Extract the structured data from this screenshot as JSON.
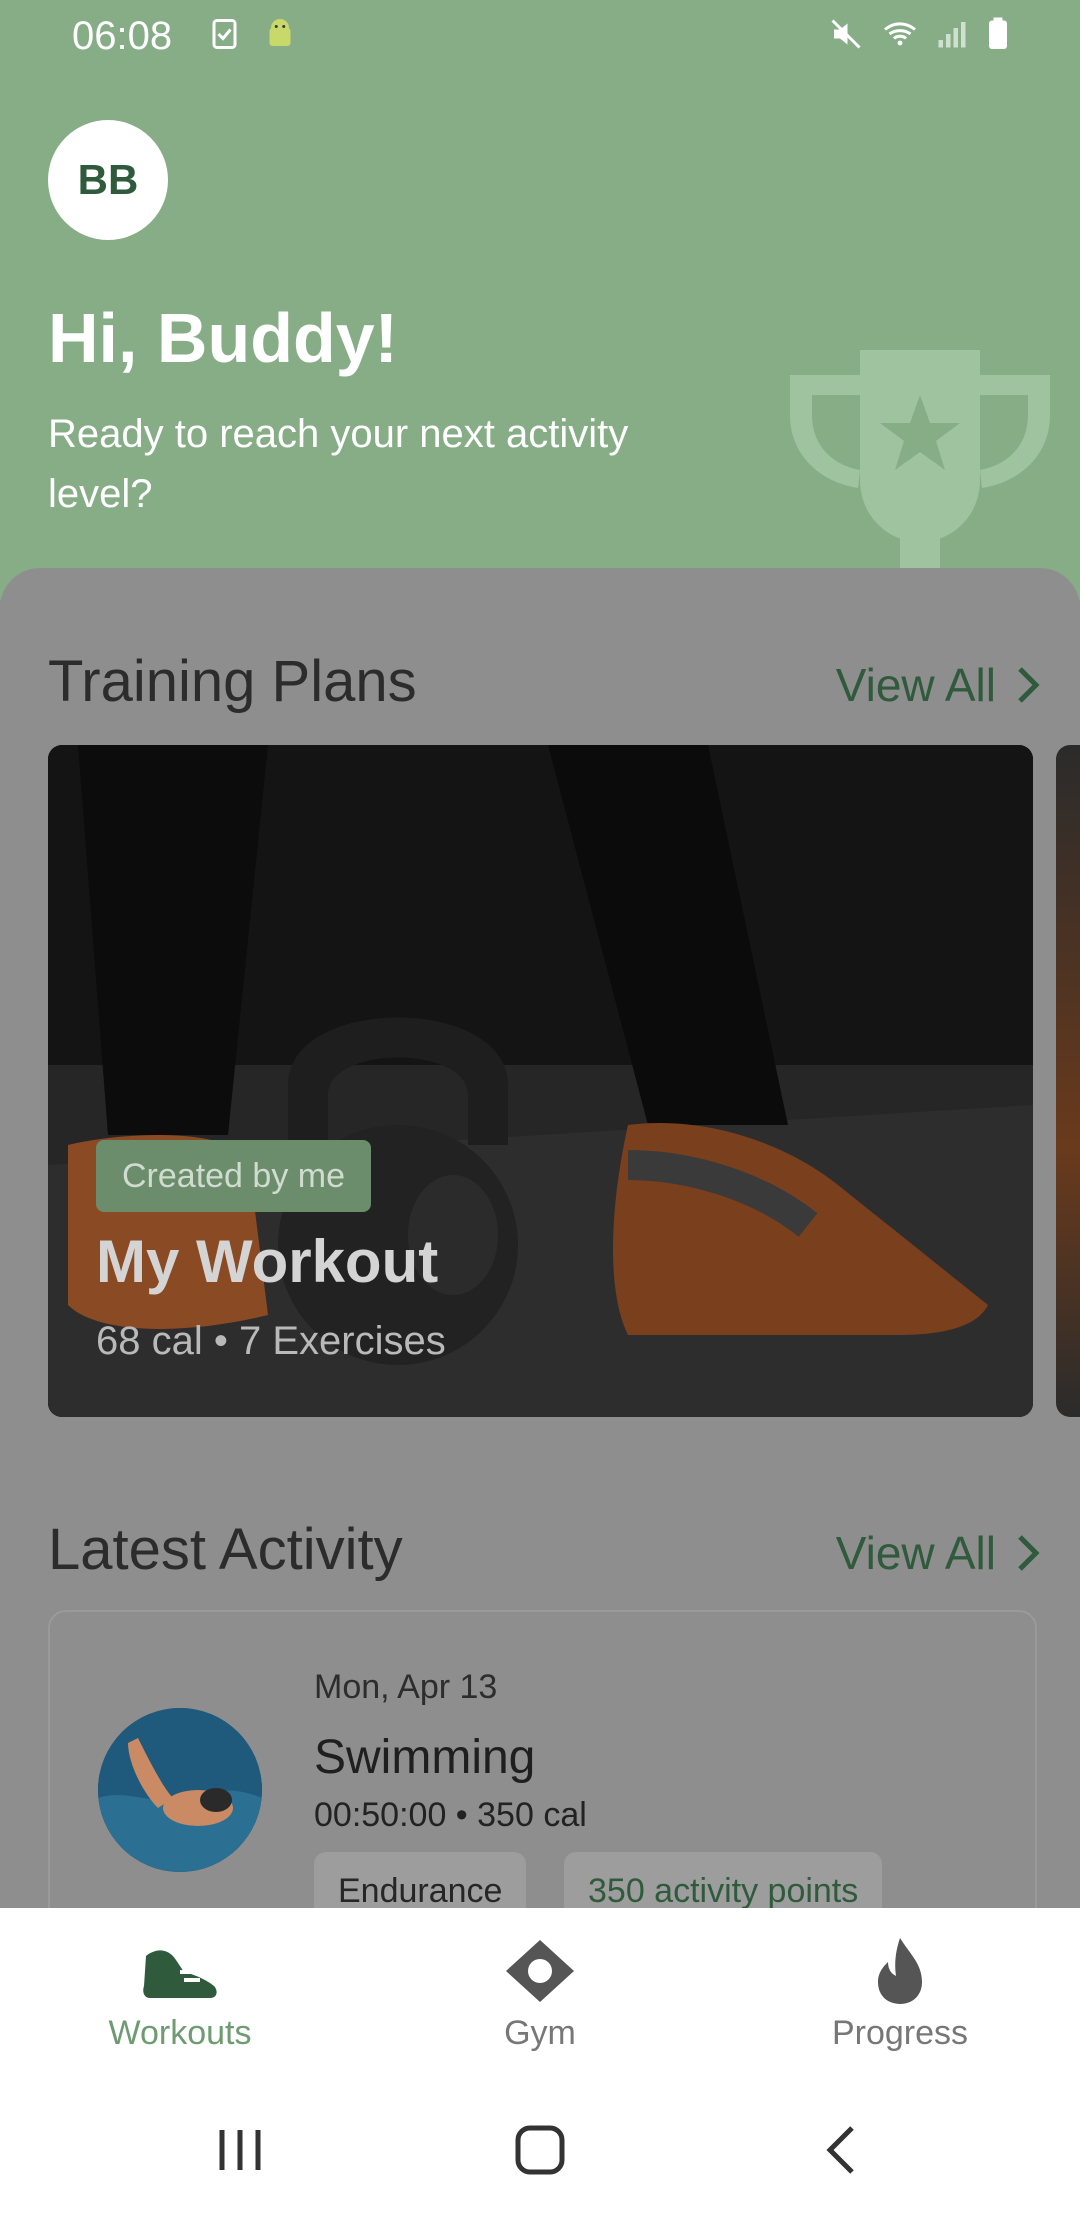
{
  "status_bar": {
    "time": "06:08",
    "icons": [
      "clipboard-check-icon",
      "android-icon",
      "mute-icon",
      "wifi-icon",
      "signal-icon",
      "battery-icon"
    ]
  },
  "header": {
    "avatar_initials": "BB",
    "greeting": "Hi, Buddy!",
    "subtitle": "Ready to reach your next activity level?",
    "illustration": "trophy-icon"
  },
  "training_plans": {
    "title": "Training Plans",
    "view_all": "View All",
    "card": {
      "badge": "Created by me",
      "title": "My Workout",
      "meta": "68 cal • 7 Exercises"
    }
  },
  "latest_activity": {
    "title": "Latest Activity",
    "view_all": "View All",
    "item": {
      "date": "Mon, Apr 13",
      "name": "Swimming",
      "meta": "00:50:00 • 350 cal",
      "tags": [
        "Endurance",
        "350 activity points"
      ]
    }
  },
  "bottom_nav": {
    "items": [
      {
        "label": "Workouts",
        "icon": "sneaker-icon",
        "active": true
      },
      {
        "label": "Gym",
        "icon": "location-diamond-icon",
        "active": false
      },
      {
        "label": "Progress",
        "icon": "flame-icon",
        "active": false
      }
    ]
  },
  "colors": {
    "header_green": "#87ad87",
    "accent_green": "#2f5b3c",
    "active_nav": "#6f9b72"
  }
}
